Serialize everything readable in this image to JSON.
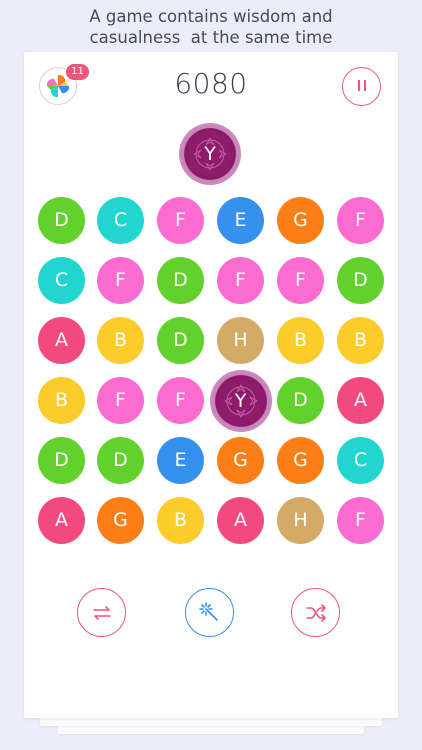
{
  "tagline": {
    "line1": "A game contains wisdom and",
    "line2": "casualness  at the same time"
  },
  "header": {
    "badge_count": "11",
    "score": "6080"
  },
  "current_tile": {
    "letter": "Y",
    "color": "#8d1c6a"
  },
  "colors": {
    "A": "#f24a80",
    "B": "#fbcc2a",
    "C": "#22d6d0",
    "D": "#60d22b",
    "E": "#3590ee",
    "F": "#fc6bd0",
    "G": "#fc7e16",
    "H": "#d4ab66",
    "accent_pink": "#f2557e",
    "accent_blue": "#3590ee"
  },
  "board": [
    [
      "D",
      "C",
      "F",
      "E",
      "G",
      "F"
    ],
    [
      "C",
      "F",
      "D",
      "F",
      "F",
      "D"
    ],
    [
      "A",
      "B",
      "D",
      "H",
      "B",
      "B"
    ],
    [
      "B",
      "F",
      "F",
      "Y",
      "D",
      "A"
    ],
    [
      "D",
      "D",
      "E",
      "G",
      "G",
      "C"
    ],
    [
      "A",
      "G",
      "B",
      "A",
      "H",
      "F"
    ]
  ],
  "controls": [
    {
      "name": "swap-arrows-icon"
    },
    {
      "name": "magic-wand-icon"
    },
    {
      "name": "shuffle-icon"
    }
  ]
}
